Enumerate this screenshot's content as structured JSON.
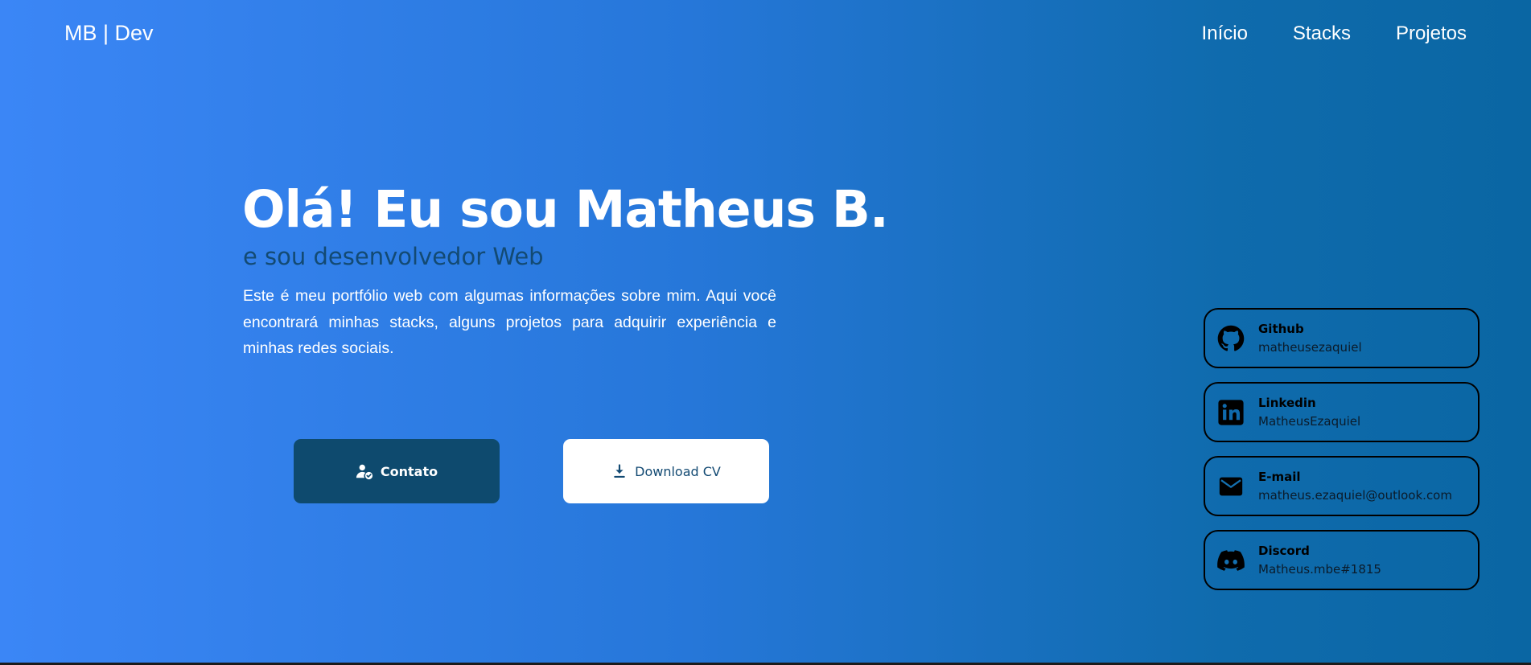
{
  "header": {
    "brand": "MB | Dev",
    "nav": [
      {
        "label": "Início"
      },
      {
        "label": "Stacks"
      },
      {
        "label": "Projetos"
      }
    ]
  },
  "hero": {
    "title": "Olá! Eu sou Matheus B.",
    "subtitle": "e sou desenvolvedor Web",
    "description": "Este é meu portfólio web com algumas informações sobre mim. Aqui você encontrará minhas stacks, alguns projetos para adquirir experiência e minhas redes sociais.",
    "contact_button": {
      "label": "Contato",
      "icon": "user-check-icon"
    },
    "cv_button": {
      "label": "Download CV",
      "icon": "download-icon"
    }
  },
  "socials": [
    {
      "title": "Github",
      "handle": "matheusezaquiel",
      "icon": "github-icon"
    },
    {
      "title": "Linkedin",
      "handle": "MatheusEzaquiel",
      "icon": "linkedin-icon"
    },
    {
      "title": "E-mail",
      "handle": "matheus.ezaquiel@outlook.com",
      "icon": "mail-icon"
    },
    {
      "title": "Discord",
      "handle": "Matheus.mbe#1815",
      "icon": "discord-icon"
    }
  ],
  "colors": {
    "gradient_start": "#3b86f6",
    "gradient_end": "#0a66a3",
    "primary_button": "#0e4a6e",
    "subtitle": "#134a73"
  }
}
